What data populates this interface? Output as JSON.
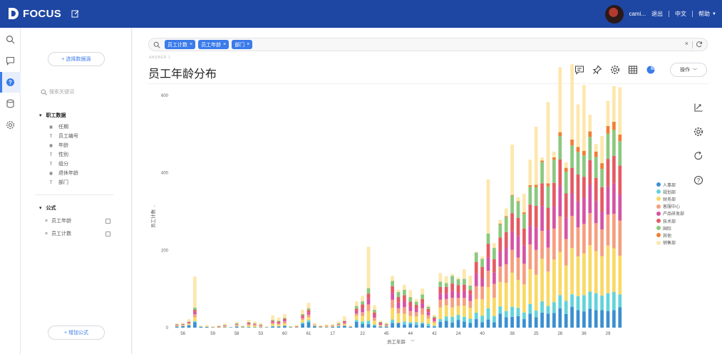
{
  "app": {
    "logo_text": "FOCUS"
  },
  "header": {
    "username": "cami...",
    "logout": "退出",
    "language": "中文",
    "help": "帮助"
  },
  "sidepanel": {
    "select_source": "选择数据源",
    "search_placeholder": "搜索关键词",
    "group_title": "职工数据",
    "columns": [
      {
        "label": "任期",
        "type": "date"
      },
      {
        "label": "员工编号",
        "type": "text"
      },
      {
        "label": "年龄",
        "type": "date"
      },
      {
        "label": "性别",
        "type": "text"
      },
      {
        "label": "组分",
        "type": "text"
      },
      {
        "label": "退休年龄",
        "type": "date"
      },
      {
        "label": "部门",
        "type": "text"
      }
    ],
    "formula_title": "公式",
    "formulas": [
      "员工年龄",
      "员工计数"
    ],
    "add_formula": "增加公式"
  },
  "search": {
    "tokens": [
      "员工计数",
      "员工年龄",
      "部门"
    ]
  },
  "main": {
    "breadcrumb": "ANSWER 1",
    "title": "员工年龄分布",
    "operate": "操作"
  },
  "colors": {
    "header_bg": "#1e46a3",
    "accent": "#3b7bea"
  },
  "chart_data": {
    "type": "bar",
    "stacked": true,
    "xlabel": "员工年龄",
    "ylabel": "员工计数",
    "ylim": [
      0,
      600
    ],
    "yticks": [
      0,
      200,
      400,
      600
    ],
    "xtick_labels": [
      "56",
      "59",
      "58",
      "53",
      "60",
      "61",
      "17",
      "22",
      "45",
      "44",
      "42",
      "24",
      "40",
      "38",
      "25",
      "28",
      "36",
      "29"
    ],
    "legend_position": "right",
    "series": [
      {
        "name": "人事部",
        "color": "#3b8fd1",
        "values": [
          3,
          4,
          6,
          14,
          2,
          2,
          1,
          0,
          1,
          1,
          3,
          1,
          1,
          1,
          1,
          1,
          3,
          3,
          5,
          1,
          1,
          10,
          14,
          4,
          1,
          1,
          2,
          3,
          5,
          2,
          15,
          10,
          9,
          5,
          3,
          3,
          12,
          12,
          8,
          10,
          7,
          10,
          4,
          3,
          15,
          18,
          13,
          20,
          16,
          12,
          22,
          14,
          21,
          14,
          36,
          27,
          28,
          30,
          22,
          36,
          27,
          39,
          36,
          38,
          50,
          35,
          54,
          45,
          42,
          49,
          45,
          45,
          43,
          45,
          53
        ]
      },
      {
        "name": "规划部",
        "color": "#62d3d9",
        "values": [
          0,
          0,
          1,
          3,
          0,
          0,
          0,
          0,
          0,
          0,
          0,
          0,
          1,
          0,
          0,
          0,
          1,
          0,
          0,
          0,
          0,
          3,
          5,
          0,
          0,
          0,
          0,
          1,
          0,
          0,
          5,
          6,
          9,
          3,
          0,
          0,
          9,
          0,
          8,
          4,
          7,
          3,
          6,
          2,
          7,
          11,
          15,
          13,
          12,
          11,
          17,
          17,
          29,
          16,
          19,
          16,
          26,
          21,
          17,
          25,
          17,
          29,
          20,
          28,
          34,
          34,
          32,
          36,
          42,
          44,
          44,
          38,
          46,
          47,
          33
        ]
      },
      {
        "name": "财务部",
        "color": "#f8d964",
        "values": [
          2,
          2,
          3,
          10,
          0,
          2,
          1,
          1,
          2,
          0,
          3,
          1,
          4,
          4,
          2,
          0,
          5,
          5,
          6,
          1,
          1,
          7,
          8,
          2,
          1,
          2,
          1,
          2,
          4,
          1,
          11,
          14,
          25,
          10,
          3,
          2,
          30,
          25,
          20,
          16,
          15,
          21,
          14,
          8,
          30,
          29,
          24,
          23,
          29,
          28,
          35,
          42,
          55,
          47,
          63,
          73,
          88,
          72,
          73,
          90,
          93,
          110,
          89,
          110,
          112,
          92,
          120,
          103,
          108,
          120,
          109,
          102,
          123,
          113,
          100
        ]
      },
      {
        "name": "客服中心",
        "color": "#f59e7f",
        "values": [
          1,
          1,
          2,
          8,
          0,
          0,
          0,
          0,
          1,
          0,
          1,
          1,
          3,
          3,
          2,
          0,
          4,
          3,
          5,
          0,
          1,
          5,
          7,
          1,
          0,
          1,
          1,
          1,
          3,
          1,
          6,
          10,
          17,
          8,
          1,
          1,
          21,
          13,
          17,
          13,
          11,
          16,
          8,
          4,
          20,
          16,
          25,
          21,
          20,
          18,
          33,
          33,
          42,
          36,
          40,
          48,
          59,
          58,
          53,
          64,
          64,
          72,
          62,
          80,
          92,
          68,
          83,
          75,
          76,
          83,
          72,
          69,
          80,
          89,
          91
        ]
      },
      {
        "name": "产品研发部",
        "color": "#d653a4",
        "values": [
          1,
          1,
          1,
          6,
          0,
          0,
          0,
          1,
          1,
          0,
          1,
          0,
          2,
          1,
          1,
          0,
          2,
          2,
          4,
          0,
          0,
          3,
          6,
          1,
          0,
          0,
          0,
          1,
          2,
          0,
          6,
          9,
          14,
          7,
          3,
          1,
          18,
          15,
          16,
          12,
          9,
          13,
          8,
          5,
          16,
          14,
          18,
          14,
          18,
          16,
          33,
          22,
          34,
          30,
          39,
          43,
          48,
          56,
          47,
          48,
          58,
          64,
          46,
          57,
          79,
          56,
          57,
          67,
          67,
          73,
          57,
          46,
          73,
          79,
          68
        ]
      },
      {
        "name": "技术部",
        "color": "#e45b63",
        "values": [
          1,
          1,
          2,
          5,
          0,
          0,
          0,
          1,
          1,
          0,
          1,
          0,
          2,
          1,
          1,
          0,
          3,
          3,
          3,
          0,
          1,
          4,
          5,
          0,
          1,
          1,
          1,
          1,
          3,
          0,
          6,
          11,
          14,
          6,
          3,
          1,
          17,
          14,
          15,
          12,
          10,
          11,
          8,
          4,
          17,
          17,
          19,
          19,
          16,
          12,
          30,
          29,
          36,
          34,
          36,
          40,
          47,
          47,
          44,
          55,
          56,
          59,
          57,
          61,
          68,
          62,
          67,
          70,
          55,
          64,
          60,
          63,
          71,
          71,
          74
        ]
      },
      {
        "name": "国际",
        "color": "#8bc87f",
        "values": [
          1,
          1,
          1,
          6,
          1,
          0,
          0,
          1,
          1,
          0,
          2,
          1,
          1,
          1,
          1,
          0,
          2,
          2,
          2,
          1,
          0,
          3,
          4,
          0,
          1,
          0,
          1,
          2,
          1,
          0,
          7,
          8,
          14,
          7,
          2,
          2,
          14,
          13,
          14,
          12,
          8,
          12,
          6,
          3,
          14,
          10,
          20,
          15,
          15,
          12,
          24,
          21,
          26,
          29,
          34,
          39,
          45,
          41,
          38,
          46,
          48,
          55,
          55,
          60,
          60,
          56,
          58,
          58,
          55,
          60,
          54,
          47,
          65,
          67,
          63
        ]
      },
      {
        "name": "其他",
        "color": "#f07e33",
        "values": [
          0,
          0,
          0,
          0,
          0,
          0,
          0,
          0,
          0,
          0,
          0,
          0,
          0,
          0,
          0,
          0,
          0,
          0,
          0,
          0,
          0,
          0,
          1,
          0,
          0,
          0,
          0,
          0,
          0,
          0,
          0,
          0,
          0,
          0,
          0,
          0,
          0,
          0,
          0,
          0,
          0,
          0,
          0,
          0,
          0,
          0,
          0,
          0,
          0,
          0,
          0,
          0,
          0,
          0,
          2,
          2,
          2,
          2,
          4,
          4,
          6,
          4,
          8,
          6,
          10,
          10,
          15,
          13,
          12,
          14,
          14,
          15,
          20,
          21,
          17
        ]
      },
      {
        "name": "销售部",
        "color": "#fde7ad",
        "values": [
          2,
          2,
          6,
          80,
          2,
          3,
          2,
          2,
          4,
          1,
          4,
          1,
          6,
          5,
          4,
          2,
          12,
          8,
          10,
          1,
          3,
          11,
          14,
          4,
          2,
          4,
          4,
          5,
          11,
          2,
          12,
          14,
          107,
          12,
          3,
          3,
          13,
          6,
          13,
          18,
          7,
          15,
          4,
          4,
          22,
          18,
          5,
          5,
          25,
          25,
          2,
          6,
          140,
          12,
          10,
          20,
          130,
          10,
          48,
          66,
          150,
          8,
          210,
          15,
          168,
          14,
          195,
          110,
          170,
          43,
          20,
          70,
          65,
          92,
          122
        ]
      }
    ]
  }
}
